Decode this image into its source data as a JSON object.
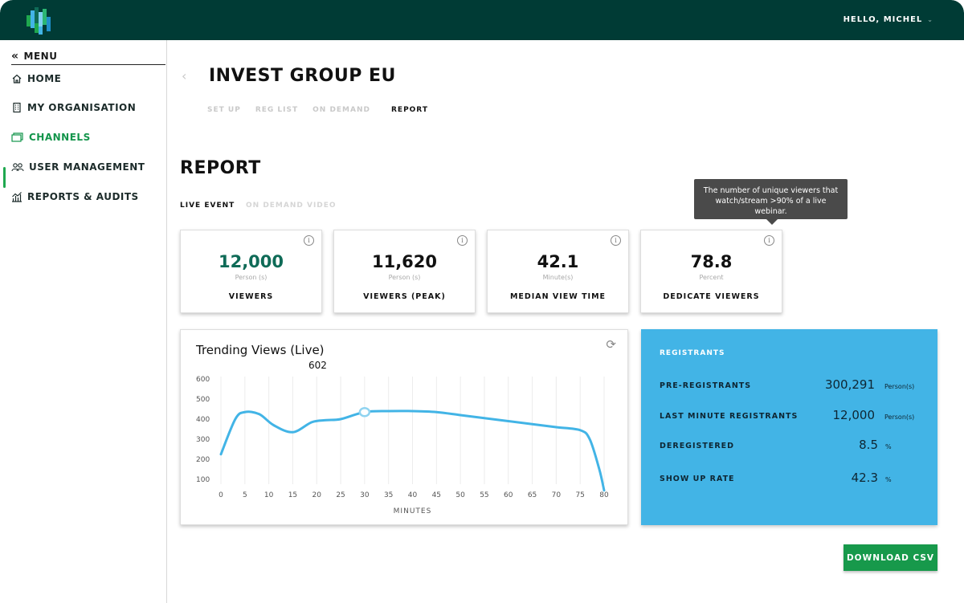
{
  "header": {
    "user_greeting": "HELLO, MICHEL",
    "colors": {
      "bar": "#003b35",
      "accent": "#1fa84f"
    }
  },
  "sidebar": {
    "menu_label": "MENU",
    "items": [
      {
        "label": "HOME",
        "icon": "home-icon",
        "active": false
      },
      {
        "label": "MY ORGANISATION",
        "icon": "building-icon",
        "active": false
      },
      {
        "label": "CHANNELS",
        "icon": "channels-icon",
        "active": true
      },
      {
        "label": "USER MANAGEMENT",
        "icon": "users-icon",
        "active": false
      },
      {
        "label": "REPORTS & AUDITS",
        "icon": "reports-icon",
        "active": false
      }
    ]
  },
  "page": {
    "title": "INVEST GROUP EU",
    "tabs": [
      {
        "label": "SET UP",
        "active": false
      },
      {
        "label": "REG LIST",
        "active": false
      },
      {
        "label": "ON DEMAND",
        "active": false
      },
      {
        "label": "REPORT",
        "active": true
      }
    ]
  },
  "report": {
    "title": "REPORT",
    "subtabs": [
      {
        "label": "LIVE EVENT",
        "active": true
      },
      {
        "label": "ON DEMAND VIDEO",
        "active": false
      }
    ],
    "tooltip": "The number of unique viewers that watch/stream >90% of a live webinar.",
    "stats": [
      {
        "value": "12,000",
        "unit": "Person (s)",
        "label": "VIEWERS",
        "highlight": true
      },
      {
        "value": "11,620",
        "unit": "Person (s)",
        "label": "VIEWERS (PEAK)",
        "highlight": false
      },
      {
        "value": "42.1",
        "unit": "Minute(s)",
        "label": "MEDIAN VIEW TIME",
        "highlight": false
      },
      {
        "value": "78.8",
        "unit": "Percent",
        "label": "DEDICATE VIEWERS",
        "highlight": false
      }
    ]
  },
  "registrants": {
    "title": "REGISTRANTS",
    "rows": [
      {
        "label": "PRE-REGISTRANTS",
        "value": "300,291",
        "unit": "Person(s)"
      },
      {
        "label": "LAST MINUTE REGISTRANTS",
        "value": "12,000",
        "unit": "Person(s)"
      },
      {
        "label": "DEREGISTERED",
        "value": "8.5",
        "unit": "%"
      },
      {
        "label": "SHOW UP RATE",
        "value": "42.3",
        "unit": "%"
      }
    ],
    "color": "#42b4e6"
  },
  "actions": {
    "download_label": "DOWNLOAD CSV"
  },
  "chart_data": {
    "type": "line",
    "title": "Trending Views (Live)",
    "current_value": "602",
    "xlabel": "MINUTES",
    "ylabel": "",
    "x_ticks": [
      0,
      5,
      10,
      15,
      20,
      25,
      30,
      35,
      40,
      45,
      50,
      55,
      60,
      65,
      70,
      75,
      80
    ],
    "y_ticks": [
      100,
      200,
      300,
      400,
      500,
      600
    ],
    "xlim": [
      0,
      80
    ],
    "ylim": [
      100,
      600
    ],
    "grid": "vertical",
    "series": [
      {
        "color": "#42b4e6",
        "x": [
          0,
          3,
          5,
          8,
          11,
          15,
          19,
          22,
          25,
          30,
          35,
          40,
          45,
          50,
          55,
          60,
          65,
          70,
          75,
          77,
          79,
          80
        ],
        "y": [
          225,
          400,
          435,
          425,
          370,
          335,
          385,
          395,
          400,
          435,
          440,
          440,
          435,
          420,
          405,
          390,
          375,
          360,
          345,
          300,
          150,
          45
        ]
      }
    ],
    "highlight_point": {
      "x": 30,
      "y": 435
    }
  }
}
